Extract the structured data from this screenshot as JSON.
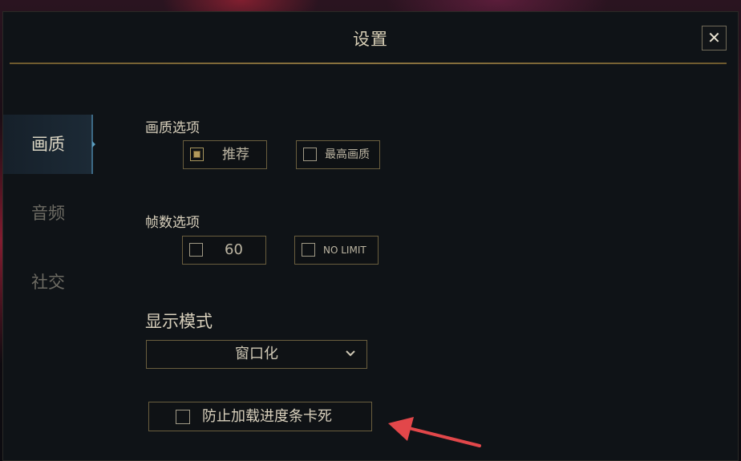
{
  "dialog": {
    "title": "设置",
    "close_label": "✕"
  },
  "sidebar": {
    "items": [
      {
        "label": "画质",
        "active": true
      },
      {
        "label": "音频",
        "active": false
      },
      {
        "label": "社交",
        "active": false
      }
    ]
  },
  "graphics": {
    "label": "画质选项",
    "options": [
      {
        "label": "推荐",
        "checked": true
      },
      {
        "label": "最高画质",
        "checked": false
      }
    ]
  },
  "framerate": {
    "label": "帧数选项",
    "options": [
      {
        "label": "60",
        "checked": false
      },
      {
        "label": "NO LIMIT",
        "checked": false
      }
    ]
  },
  "display_mode": {
    "label": "显示模式",
    "selected": "窗口化"
  },
  "anti_stuck": {
    "label": "防止加载进度条卡死",
    "checked": false
  },
  "colors": {
    "accent_gold": "#6a5e3e",
    "active_blue": "#3d6a86",
    "annotation_arrow": "#e2474a"
  }
}
